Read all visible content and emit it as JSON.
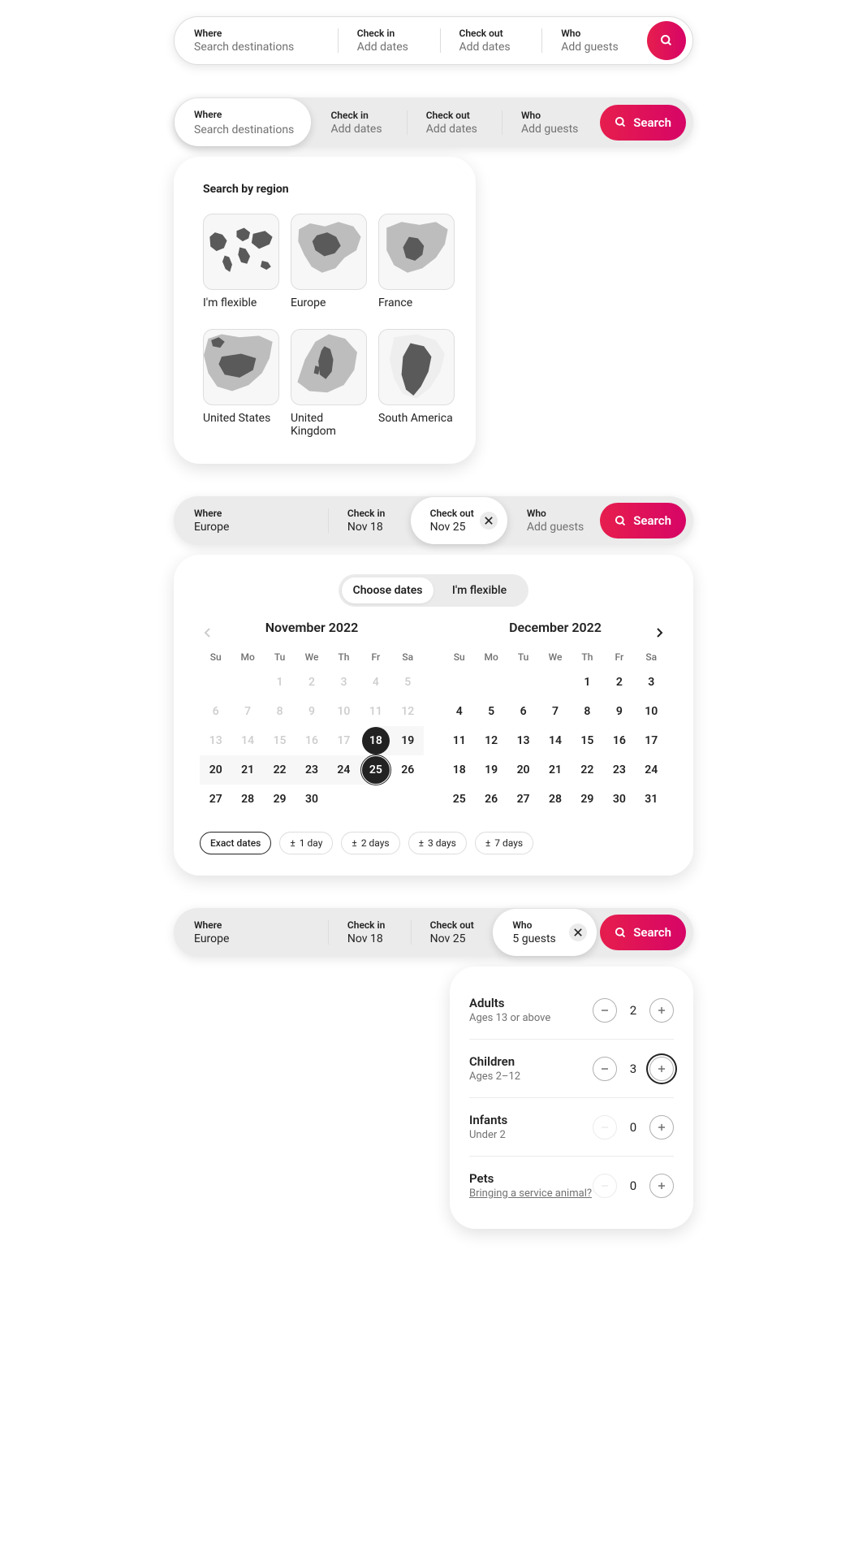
{
  "search": {
    "where_label": "Where",
    "where_placeholder": "Search destinations",
    "checkin_label": "Check in",
    "checkout_label": "Check out",
    "add_dates": "Add dates",
    "who_label": "Who",
    "add_guests": "Add guests",
    "search_label": "Search"
  },
  "region_panel": {
    "title": "Search by region",
    "items": [
      "I'm flexible",
      "Europe",
      "France",
      "United States",
      "United Kingdom",
      "South America"
    ]
  },
  "bar3": {
    "where_value": "Europe",
    "checkin_value": "Nov 18",
    "checkout_value": "Nov 25"
  },
  "date_panel": {
    "tab_choose": "Choose dates",
    "tab_flexible": "I'm flexible",
    "month1": "November 2022",
    "month2": "December 2022",
    "weekdays": [
      "Su",
      "Mo",
      "Tu",
      "We",
      "Th",
      "Fr",
      "Sa"
    ],
    "chips": [
      "Exact dates",
      "1 day",
      "2 days",
      "3 days",
      "7 days"
    ]
  },
  "bar4": {
    "where_value": "Europe",
    "checkin_value": "Nov 18",
    "checkout_value": "Nov 25",
    "who_value": "5 guests"
  },
  "guests_panel": {
    "rows": [
      {
        "title": "Adults",
        "sub": "Ages 13 or above",
        "value": "2",
        "minus_disabled": false
      },
      {
        "title": "Children",
        "sub": "Ages 2–12",
        "value": "3",
        "minus_disabled": false,
        "plus_focus": true
      },
      {
        "title": "Infants",
        "sub": "Under 2",
        "value": "0",
        "minus_disabled": true
      },
      {
        "title": "Pets",
        "sub": "Bringing a service animal?",
        "sub_link": true,
        "value": "0",
        "minus_disabled": true
      }
    ]
  },
  "nov_days": [
    [
      {
        "v": ""
      },
      {
        "v": ""
      },
      {
        "v": "1",
        "m": 1
      },
      {
        "v": "2",
        "m": 1
      },
      {
        "v": "3",
        "m": 1
      },
      {
        "v": "4",
        "m": 1
      },
      {
        "v": "5",
        "m": 1
      }
    ],
    [
      {
        "v": "6",
        "m": 1
      },
      {
        "v": "7",
        "m": 1
      },
      {
        "v": "8",
        "m": 1
      },
      {
        "v": "9",
        "m": 1
      },
      {
        "v": "10",
        "m": 1
      },
      {
        "v": "11",
        "m": 1
      },
      {
        "v": "12",
        "m": 1
      }
    ],
    [
      {
        "v": "13",
        "m": 1
      },
      {
        "v": "14",
        "m": 1
      },
      {
        "v": "15",
        "m": 1
      },
      {
        "v": "16",
        "m": 1
      },
      {
        "v": "17",
        "m": 1
      },
      {
        "v": "18",
        "start": 1
      },
      {
        "v": "19",
        "r": 1
      }
    ],
    [
      {
        "v": "20",
        "r": 1
      },
      {
        "v": "21",
        "r": 1
      },
      {
        "v": "22",
        "r": 1
      },
      {
        "v": "23",
        "r": 1
      },
      {
        "v": "24",
        "r": 1
      },
      {
        "v": "25",
        "end": 1
      },
      {
        "v": "26"
      }
    ],
    [
      {
        "v": "27"
      },
      {
        "v": "28"
      },
      {
        "v": "29"
      },
      {
        "v": "30"
      },
      {
        "v": ""
      },
      {
        "v": ""
      },
      {
        "v": ""
      }
    ]
  ],
  "dec_days": [
    [
      {
        "v": ""
      },
      {
        "v": ""
      },
      {
        "v": ""
      },
      {
        "v": ""
      },
      {
        "v": "1"
      },
      {
        "v": "2"
      },
      {
        "v": "3"
      }
    ],
    [
      {
        "v": "4"
      },
      {
        "v": "5"
      },
      {
        "v": "6"
      },
      {
        "v": "7"
      },
      {
        "v": "8"
      },
      {
        "v": "9"
      },
      {
        "v": "10"
      }
    ],
    [
      {
        "v": "11"
      },
      {
        "v": "12"
      },
      {
        "v": "13"
      },
      {
        "v": "14"
      },
      {
        "v": "15"
      },
      {
        "v": "16"
      },
      {
        "v": "17"
      }
    ],
    [
      {
        "v": "18"
      },
      {
        "v": "19"
      },
      {
        "v": "20"
      },
      {
        "v": "21"
      },
      {
        "v": "22"
      },
      {
        "v": "23"
      },
      {
        "v": "24"
      }
    ],
    [
      {
        "v": "25"
      },
      {
        "v": "26"
      },
      {
        "v": "27"
      },
      {
        "v": "28"
      },
      {
        "v": "29"
      },
      {
        "v": "30"
      },
      {
        "v": "31"
      }
    ]
  ]
}
